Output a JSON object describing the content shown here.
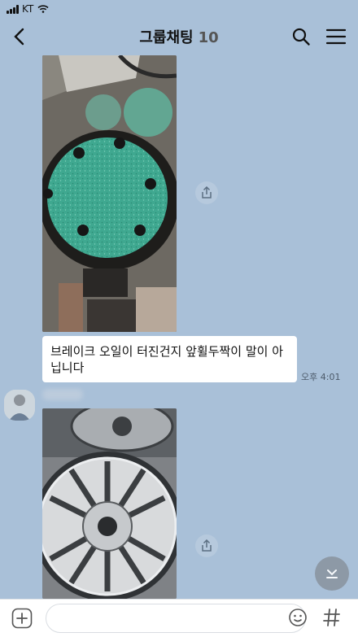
{
  "status_bar": {
    "carrier": "KT"
  },
  "header": {
    "title": "그룹채팅",
    "member_count": "10"
  },
  "messages": {
    "photo_1": {
      "subject": "brake rotor photo"
    },
    "text_1": {
      "text": "브레이크 오일이 터진건지 앞휠두짝이 말이 아닙니다",
      "time": "오후 4:01"
    },
    "photo_2": {
      "subject": "alloy wheel photo"
    }
  },
  "input_bar": {
    "placeholder": ""
  },
  "icons": {
    "back": "chevron-left-icon",
    "search": "search-icon",
    "menu": "hamburger-menu-icon",
    "share": "share-icon",
    "scroll_down": "chevron-down-icon",
    "attach": "plus-icon",
    "emoji": "emoji-icon",
    "hashtag": "hashtag-icon"
  },
  "colors": {
    "background": "#a9c0d8",
    "bubble": "#ffffff",
    "input_bar": "#ffffff"
  }
}
